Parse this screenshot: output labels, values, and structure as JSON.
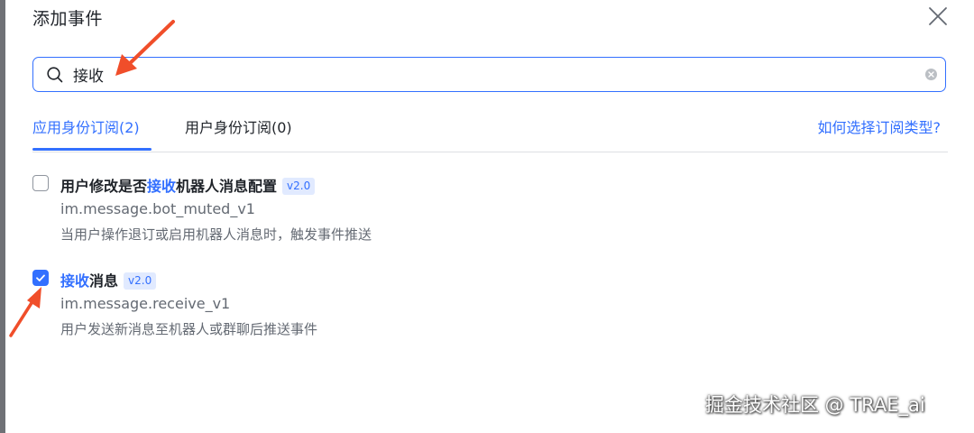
{
  "dialog": {
    "title": "添加事件",
    "close_icon": "close-icon"
  },
  "search": {
    "value": "接收",
    "placeholder": "",
    "search_icon": "search-icon",
    "clear_icon": "clear-icon"
  },
  "tabs": [
    {
      "label": "应用身份订阅(2)",
      "active": true
    },
    {
      "label": "用户身份订阅(0)",
      "active": false
    }
  ],
  "help_link": "如何选择订阅类型?",
  "events": [
    {
      "checked": false,
      "title_before": "用户修改是否",
      "title_highlight": "接收",
      "title_after": "机器人消息配置",
      "version": "v2.0",
      "event_id": "im.message.bot_muted_v1",
      "description": "当用户操作退订或启用机器人消息时，触发事件推送"
    },
    {
      "checked": true,
      "title_before": "",
      "title_highlight": "接收",
      "title_after": "消息",
      "version": "v2.0",
      "event_id": "im.message.receive_v1",
      "description": "用户发送新消息至机器人或群聊后推送事件"
    }
  ],
  "watermark": "掘金技术社区 @ TRAE_ai",
  "colors": {
    "accent": "#3370ff",
    "annotation_arrow": "#f04e2a",
    "text_primary": "#1f2329",
    "text_secondary": "#646a73"
  }
}
